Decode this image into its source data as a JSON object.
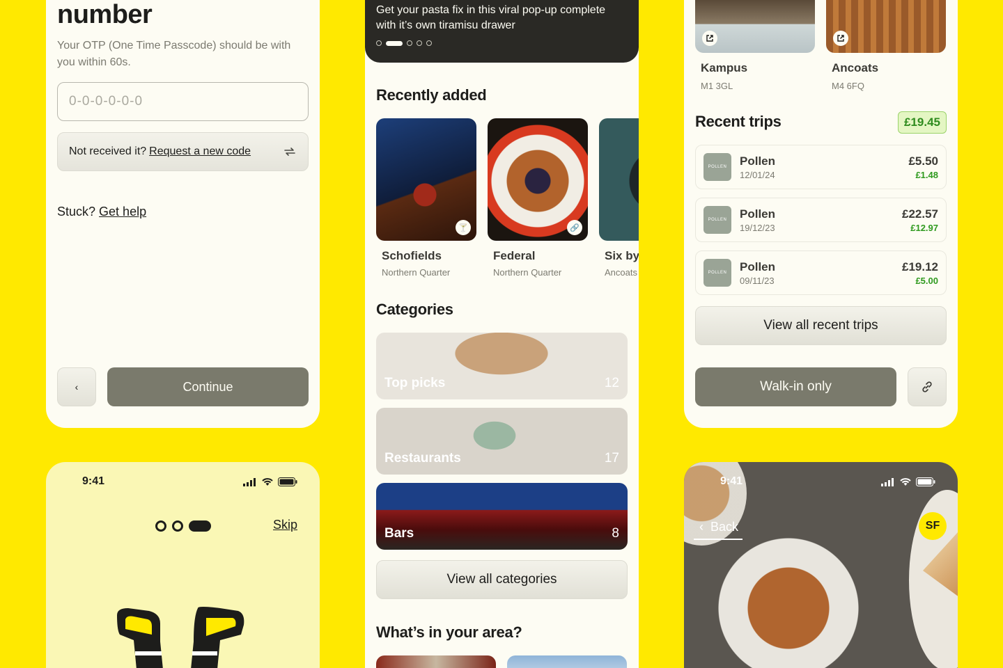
{
  "otp": {
    "title": "number",
    "description": "Your OTP (One Time Passcode) should be with you within 60s.",
    "input_placeholder": "0-0-0-0-0-0",
    "resend_prefix": "Not received it?",
    "resend_link": "Request a new code",
    "stuck_prefix": "Stuck?",
    "stuck_link": "Get help",
    "back_glyph": "‹",
    "continue_label": "Continue"
  },
  "onboarding": {
    "time": "9:41",
    "skip_label": "Skip"
  },
  "home": {
    "hero_text": "Get your pasta fix in this viral pop-up complete with it’s own tiramisu drawer",
    "recently_added_title": "Recently added",
    "venues": [
      {
        "name": "Schofields",
        "area": "Northern Quarter",
        "badge": "cocktail-icon"
      },
      {
        "name": "Federal",
        "area": "Northern Quarter",
        "badge": "link-icon"
      },
      {
        "name": "Six by",
        "area": "Ancoats"
      }
    ],
    "categories_title": "Categories",
    "categories": [
      {
        "label": "Top picks",
        "count": "12"
      },
      {
        "label": "Restaurants",
        "count": "17"
      },
      {
        "label": "Bars",
        "count": "8"
      }
    ],
    "view_all_categories": "View all categories",
    "area_title": "What’s in your area?"
  },
  "trips": {
    "locations": [
      {
        "name": "Kampus",
        "postcode": "M1 3GL"
      },
      {
        "name": "Ancoats",
        "postcode": "M4 6FQ"
      }
    ],
    "title": "Recent trips",
    "total": "£19.45",
    "items": [
      {
        "logo": "POLLEN",
        "name": "Pollen",
        "date": "12/01/24",
        "amount": "£5.50",
        "saving": "£1.48"
      },
      {
        "logo": "POLLEN",
        "name": "Pollen",
        "date": "19/12/23",
        "amount": "£22.57",
        "saving": "£12.97"
      },
      {
        "logo": "POLLEN",
        "name": "Pollen",
        "date": "09/11/23",
        "amount": "£19.12",
        "saving": "£5.00"
      }
    ],
    "view_all": "View all recent trips",
    "walkin": "Walk-in only"
  },
  "detail": {
    "time": "9:41",
    "back_label": "Back",
    "avatar_initials": "SF"
  },
  "colors": {
    "background": "#ffe900",
    "card": "#fdfcf3",
    "primary_button": "#7a7a6c",
    "saving_green": "#2f9a1f"
  }
}
